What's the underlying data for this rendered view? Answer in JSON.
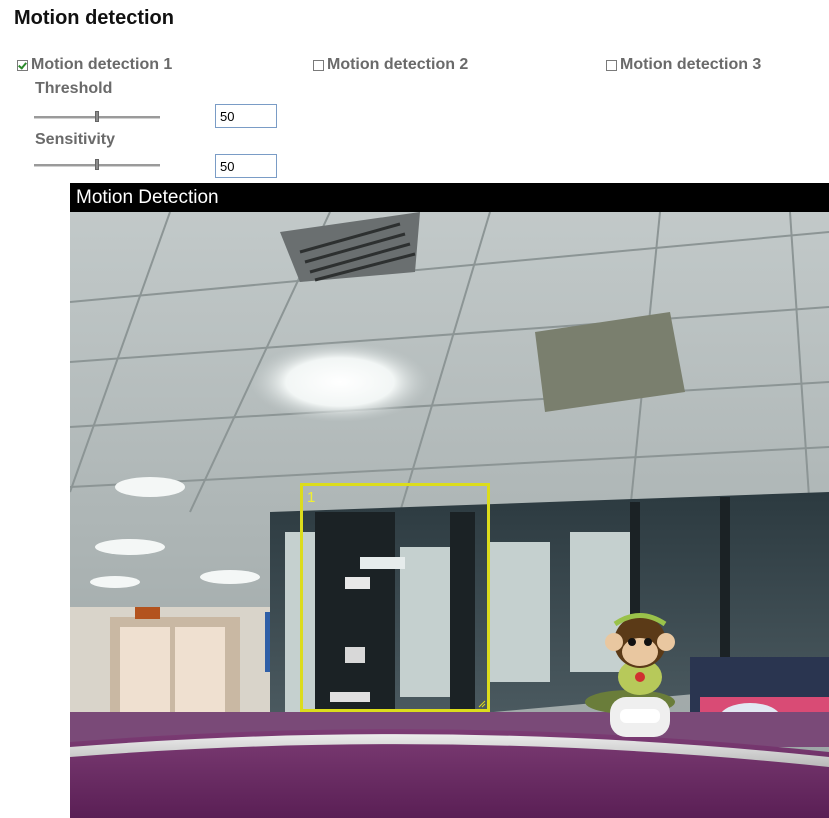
{
  "page": {
    "title": "Motion detection"
  },
  "options": [
    {
      "label": "Motion detection 1",
      "checked": true
    },
    {
      "label": "Motion detection 2",
      "checked": false
    },
    {
      "label": "Motion detection 3",
      "checked": false
    }
  ],
  "threshold": {
    "label": "Threshold",
    "value": "50",
    "level": 0.5
  },
  "sensitivity": {
    "label": "Sensitivity",
    "value": "50",
    "level": 0.5
  },
  "video": {
    "title": "Motion Detection",
    "zone": {
      "label": "1",
      "color": "#dcdc1c"
    }
  }
}
